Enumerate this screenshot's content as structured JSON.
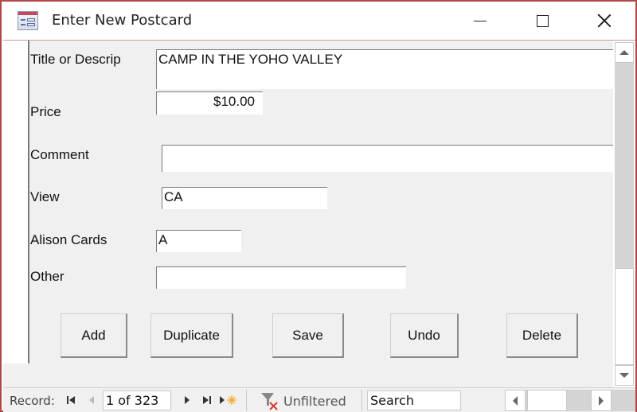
{
  "window": {
    "title": "Enter New Postcard",
    "accent_color": "#b04848"
  },
  "form": {
    "fields": [
      {
        "label": "Title or Descrip",
        "value": "CAMP IN THE YOHO VALLEY"
      },
      {
        "label": "Price",
        "value": "$10.00"
      },
      {
        "label": "Comment",
        "value": ""
      },
      {
        "label": "View",
        "value": "CA"
      },
      {
        "label": "Alison Cards",
        "value": "A"
      },
      {
        "label": "Other",
        "value": ""
      }
    ],
    "buttons": [
      "Add",
      "Duplicate",
      "Save",
      "Undo",
      "Delete"
    ]
  },
  "navigation": {
    "record_label": "Record:",
    "current_record": "1 of 323",
    "filter_status": "Unfiltered",
    "search_placeholder": "Search",
    "icons": {
      "first": "first-record-icon",
      "prev": "previous-record-icon",
      "next": "next-record-icon",
      "last": "last-record-icon",
      "new": "new-record-icon",
      "filter": "filter-cleared-icon"
    }
  }
}
